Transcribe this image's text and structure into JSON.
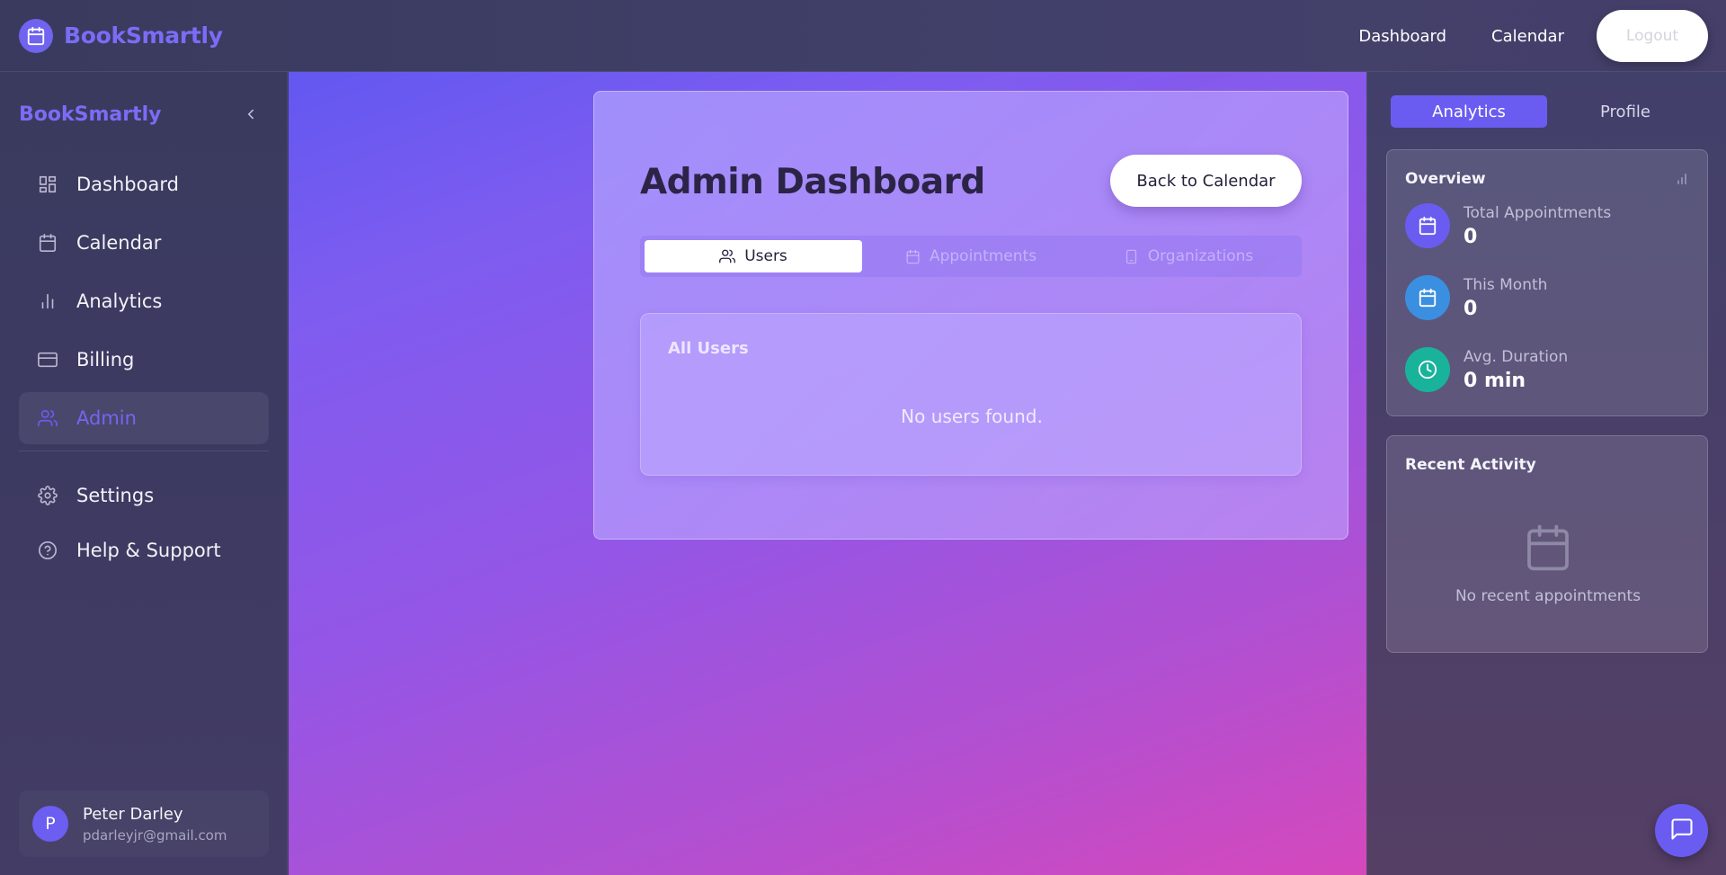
{
  "app": {
    "name": "BookSmartly",
    "icon": "calendar-icon",
    "accent": "#6a5cf0"
  },
  "topnav": {
    "links": [
      {
        "label": "Dashboard"
      },
      {
        "label": "Calendar"
      }
    ],
    "logout_label": "Logout"
  },
  "sidebar": {
    "title": "BookSmartly",
    "collapse_icon": "chevron-left-icon",
    "items": [
      {
        "label": "Dashboard",
        "icon": "dashboard-grid-icon",
        "active": false
      },
      {
        "label": "Calendar",
        "icon": "calendar-icon",
        "active": false
      },
      {
        "label": "Analytics",
        "icon": "bar-chart-icon",
        "active": false
      },
      {
        "label": "Billing",
        "icon": "credit-card-icon",
        "active": false
      },
      {
        "label": "Admin",
        "icon": "users-icon",
        "active": true
      }
    ],
    "secondary_items": [
      {
        "label": "Settings",
        "icon": "gear-icon"
      },
      {
        "label": "Help & Support",
        "icon": "help-circle-icon"
      }
    ],
    "user": {
      "initial": "P",
      "name": "Peter Darley",
      "email": "pdarleyjr@gmail.com"
    }
  },
  "main": {
    "title": "Admin Dashboard",
    "back_button": "Back to Calendar",
    "tabs": [
      {
        "label": "Users",
        "icon": "users-icon",
        "active": true
      },
      {
        "label": "Appointments",
        "icon": "calendar-icon",
        "active": false
      },
      {
        "label": "Organizations",
        "icon": "building-icon",
        "active": false
      }
    ],
    "users_card": {
      "title": "All Users",
      "empty_message": "No users found."
    }
  },
  "right_panel": {
    "tabs": [
      {
        "label": "Analytics",
        "active": true
      },
      {
        "label": "Profile",
        "active": false
      }
    ],
    "overview": {
      "title": "Overview",
      "icon": "bar-chart-icon",
      "stats": [
        {
          "label": "Total Appointments",
          "value": "0",
          "icon": "calendar-icon",
          "color": "#6a5cf0"
        },
        {
          "label": "This Month",
          "value": "0",
          "icon": "calendar-icon",
          "color": "#3b8fe0"
        },
        {
          "label": "Avg. Duration",
          "value": "0 min",
          "icon": "clock-icon",
          "color": "#19b39b"
        }
      ]
    },
    "recent_activity": {
      "title": "Recent Activity",
      "icon": "calendar-icon",
      "empty_message": "No recent appointments"
    }
  },
  "chat": {
    "icon": "chat-bubble-icon"
  }
}
